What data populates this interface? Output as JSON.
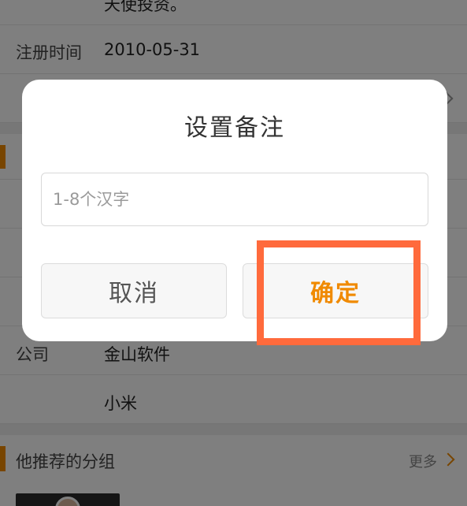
{
  "background": {
    "intro_tail": "天使投资。",
    "rows": [
      {
        "label": "注册时间",
        "value": "2010-05-31"
      },
      {
        "label": "公司",
        "value": "金山软件"
      },
      {
        "label": "",
        "value": "小米"
      }
    ],
    "section": {
      "title": "他推荐的分组",
      "more": "更多"
    }
  },
  "dialog": {
    "title": "设置备注",
    "input_placeholder": "1-8个汉字",
    "input_value": "",
    "cancel_label": "取消",
    "confirm_label": "确定"
  },
  "colors": {
    "accent": "#f08a00",
    "highlight": "#ff6a3c",
    "overlay": "rgba(0,0,0,0.5)"
  }
}
